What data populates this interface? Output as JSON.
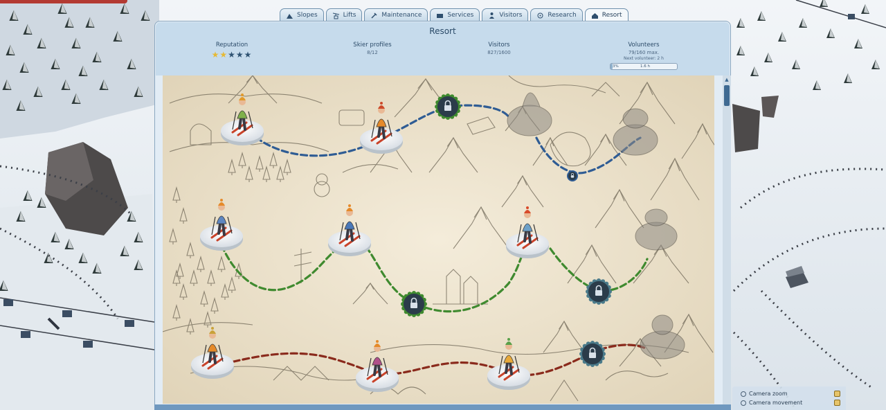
{
  "tabs": [
    {
      "label": "Slopes",
      "icon": "slopes-icon"
    },
    {
      "label": "Lifts",
      "icon": "lifts-icon"
    },
    {
      "label": "Maintenance",
      "icon": "maintenance-icon"
    },
    {
      "label": "Services",
      "icon": "services-icon"
    },
    {
      "label": "Visitors",
      "icon": "visitors-icon"
    },
    {
      "label": "Research",
      "icon": "research-icon"
    },
    {
      "label": "Resort",
      "icon": "resort-icon",
      "active": true
    }
  ],
  "panel": {
    "title": "Resort",
    "reputation": {
      "label": "Reputation",
      "stars_filled": 2,
      "stars_total": 5
    },
    "skier_profiles": {
      "label": "Skier profiles",
      "value": "8/12"
    },
    "visitors": {
      "label": "Visitors",
      "value": "827/1600"
    },
    "volunteers": {
      "label": "Volunteers",
      "value": "79/160 max.",
      "next": "Next volunteer: 2 h",
      "progress_pct": 3,
      "progress_text": "3%",
      "progress_center": "1.6 h"
    }
  },
  "map": {
    "paths": [
      {
        "color": "#2f5c94",
        "name": "blue-trail"
      },
      {
        "color": "#3f8a2f",
        "name": "green-trail"
      },
      {
        "color": "#8a2a1c",
        "name": "red-trail"
      }
    ],
    "skiers": [
      {
        "id": "skier-1",
        "tier": "blue",
        "jacket": "#7fb04a",
        "hat": "#e29a2a"
      },
      {
        "id": "skier-2",
        "tier": "blue",
        "jacket": "#e58a2a",
        "hat": "#cc4a2a"
      },
      {
        "id": "skier-3",
        "tier": "green",
        "jacket": "#5d86c0",
        "hat": "#e58a2a"
      },
      {
        "id": "skier-4",
        "tier": "green",
        "jacket": "#4a78b8",
        "hat": "#e58a2a"
      },
      {
        "id": "skier-5",
        "tier": "green",
        "jacket": "#6da0c8",
        "hat": "#d84a2a"
      },
      {
        "id": "skier-6",
        "tier": "red",
        "jacket": "#e58a2a",
        "hat": "#c9a23a"
      },
      {
        "id": "skier-7",
        "tier": "red",
        "jacket": "#b0508a",
        "hat": "#e58a2a"
      },
      {
        "id": "skier-8",
        "tier": "red",
        "jacket": "#e8a93a",
        "hat": "#5aa04a"
      }
    ],
    "locks": [
      {
        "id": "lock-1",
        "ring": "#3f8a2f"
      },
      {
        "id": "lock-2",
        "ring": "#2f5c94"
      },
      {
        "id": "lock-3",
        "ring": "#3f8a2f"
      },
      {
        "id": "lock-4",
        "ring": "#2f5c94"
      },
      {
        "id": "lock-5",
        "ring": "#2f5c94"
      }
    ]
  },
  "camera": {
    "zoom_label": "Camera zoom",
    "move_label": "Camera movement"
  },
  "colors": {
    "panel_bg": "#e2ecf5",
    "header_bg": "#c6dbec",
    "parchment": "#efe6d2",
    "snow": "#e9eef3",
    "star_on": "#e6b934",
    "star_off": "#2e5272"
  }
}
